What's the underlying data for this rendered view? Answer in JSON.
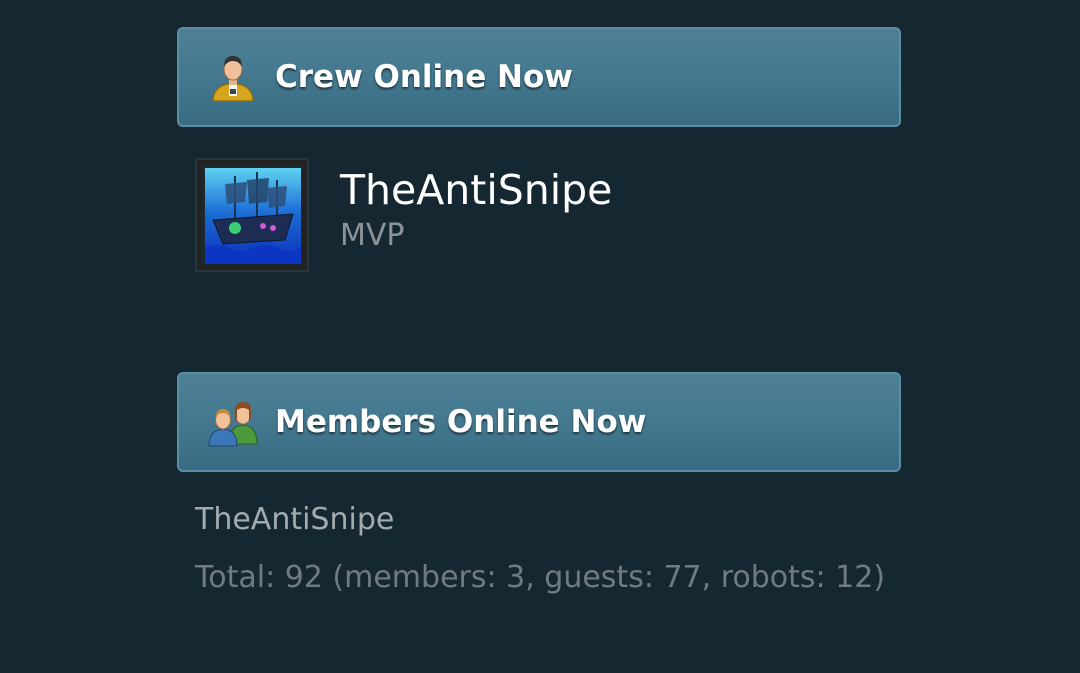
{
  "crew_panel": {
    "title": "Crew Online Now",
    "icon": "crew-user-icon",
    "members": [
      {
        "name": "TheAntiSnipe",
        "rank": "MVP",
        "avatar": "pirate-ship-avatar"
      }
    ]
  },
  "members_panel": {
    "title": "Members Online Now",
    "icon": "members-group-icon",
    "online_list": "TheAntiSnipe",
    "total_text": "Total: 92 (members: 3, guests: 77, robots: 12)"
  },
  "colors": {
    "background": "#152832",
    "header_gradient_top": "#4f8196",
    "header_gradient_bottom": "#386b82",
    "header_border": "#5c8ea3",
    "name_text": "#ffffff",
    "rank_text": "#8a9498"
  }
}
